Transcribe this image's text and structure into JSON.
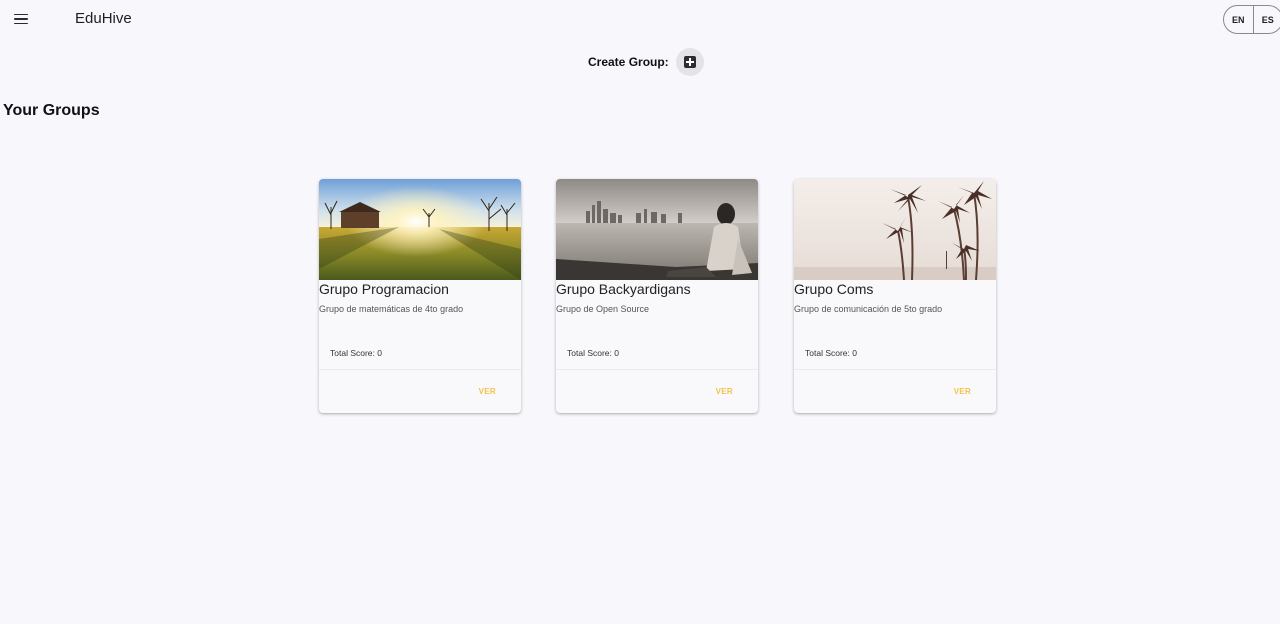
{
  "app": {
    "title": "EduHive"
  },
  "header": {
    "menu_icon": "hamburger-menu-icon",
    "languages": [
      "EN",
      "ES"
    ]
  },
  "create": {
    "label": "Create Group:",
    "icon": "add-box-icon"
  },
  "section": {
    "title": "Your Groups"
  },
  "colors": {
    "accent": "#f2c24a",
    "background": "#f8f8fc"
  },
  "groups": [
    {
      "title": "Grupo Programacion",
      "description": "Grupo de matemáticas de 4to grado",
      "score": "Total Score: 0",
      "action": "VER",
      "image": "farm-sunset-image"
    },
    {
      "title": "Grupo Backyardigans",
      "description": "Grupo de Open Source",
      "score": "Total Score: 0",
      "action": "VER",
      "image": "city-lakeshore-image"
    },
    {
      "title": "Grupo Coms",
      "description": "Grupo de comunicación de 5to grado",
      "score": "Total Score: 0",
      "action": "VER",
      "image": "palm-trees-image"
    }
  ]
}
